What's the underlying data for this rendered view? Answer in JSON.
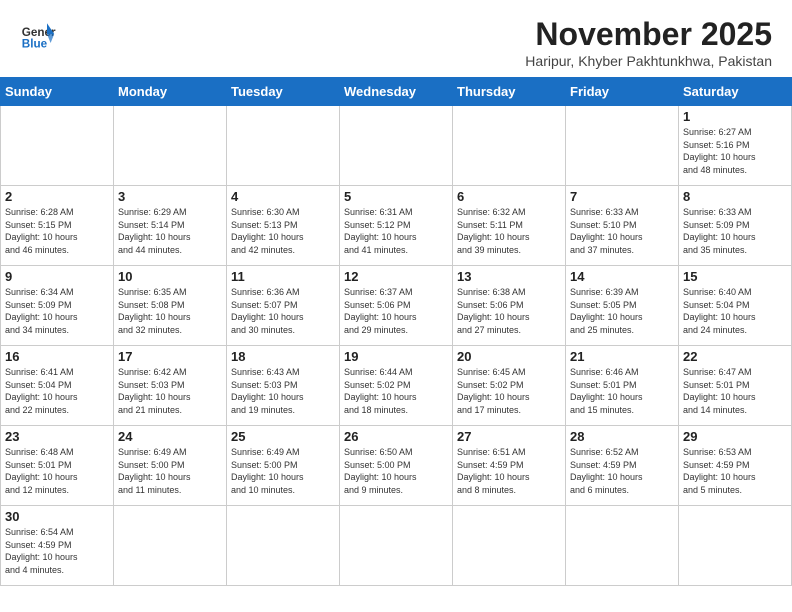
{
  "header": {
    "logo_general": "General",
    "logo_blue": "Blue",
    "month": "November 2025",
    "location": "Haripur, Khyber Pakhtunkhwa, Pakistan"
  },
  "days_of_week": [
    "Sunday",
    "Monday",
    "Tuesday",
    "Wednesday",
    "Thursday",
    "Friday",
    "Saturday"
  ],
  "weeks": [
    [
      {
        "day": "",
        "info": ""
      },
      {
        "day": "",
        "info": ""
      },
      {
        "day": "",
        "info": ""
      },
      {
        "day": "",
        "info": ""
      },
      {
        "day": "",
        "info": ""
      },
      {
        "day": "",
        "info": ""
      },
      {
        "day": "1",
        "info": "Sunrise: 6:27 AM\nSunset: 5:16 PM\nDaylight: 10 hours\nand 48 minutes."
      }
    ],
    [
      {
        "day": "2",
        "info": "Sunrise: 6:28 AM\nSunset: 5:15 PM\nDaylight: 10 hours\nand 46 minutes."
      },
      {
        "day": "3",
        "info": "Sunrise: 6:29 AM\nSunset: 5:14 PM\nDaylight: 10 hours\nand 44 minutes."
      },
      {
        "day": "4",
        "info": "Sunrise: 6:30 AM\nSunset: 5:13 PM\nDaylight: 10 hours\nand 42 minutes."
      },
      {
        "day": "5",
        "info": "Sunrise: 6:31 AM\nSunset: 5:12 PM\nDaylight: 10 hours\nand 41 minutes."
      },
      {
        "day": "6",
        "info": "Sunrise: 6:32 AM\nSunset: 5:11 PM\nDaylight: 10 hours\nand 39 minutes."
      },
      {
        "day": "7",
        "info": "Sunrise: 6:33 AM\nSunset: 5:10 PM\nDaylight: 10 hours\nand 37 minutes."
      },
      {
        "day": "8",
        "info": "Sunrise: 6:33 AM\nSunset: 5:09 PM\nDaylight: 10 hours\nand 35 minutes."
      }
    ],
    [
      {
        "day": "9",
        "info": "Sunrise: 6:34 AM\nSunset: 5:09 PM\nDaylight: 10 hours\nand 34 minutes."
      },
      {
        "day": "10",
        "info": "Sunrise: 6:35 AM\nSunset: 5:08 PM\nDaylight: 10 hours\nand 32 minutes."
      },
      {
        "day": "11",
        "info": "Sunrise: 6:36 AM\nSunset: 5:07 PM\nDaylight: 10 hours\nand 30 minutes."
      },
      {
        "day": "12",
        "info": "Sunrise: 6:37 AM\nSunset: 5:06 PM\nDaylight: 10 hours\nand 29 minutes."
      },
      {
        "day": "13",
        "info": "Sunrise: 6:38 AM\nSunset: 5:06 PM\nDaylight: 10 hours\nand 27 minutes."
      },
      {
        "day": "14",
        "info": "Sunrise: 6:39 AM\nSunset: 5:05 PM\nDaylight: 10 hours\nand 25 minutes."
      },
      {
        "day": "15",
        "info": "Sunrise: 6:40 AM\nSunset: 5:04 PM\nDaylight: 10 hours\nand 24 minutes."
      }
    ],
    [
      {
        "day": "16",
        "info": "Sunrise: 6:41 AM\nSunset: 5:04 PM\nDaylight: 10 hours\nand 22 minutes."
      },
      {
        "day": "17",
        "info": "Sunrise: 6:42 AM\nSunset: 5:03 PM\nDaylight: 10 hours\nand 21 minutes."
      },
      {
        "day": "18",
        "info": "Sunrise: 6:43 AM\nSunset: 5:03 PM\nDaylight: 10 hours\nand 19 minutes."
      },
      {
        "day": "19",
        "info": "Sunrise: 6:44 AM\nSunset: 5:02 PM\nDaylight: 10 hours\nand 18 minutes."
      },
      {
        "day": "20",
        "info": "Sunrise: 6:45 AM\nSunset: 5:02 PM\nDaylight: 10 hours\nand 17 minutes."
      },
      {
        "day": "21",
        "info": "Sunrise: 6:46 AM\nSunset: 5:01 PM\nDaylight: 10 hours\nand 15 minutes."
      },
      {
        "day": "22",
        "info": "Sunrise: 6:47 AM\nSunset: 5:01 PM\nDaylight: 10 hours\nand 14 minutes."
      }
    ],
    [
      {
        "day": "23",
        "info": "Sunrise: 6:48 AM\nSunset: 5:01 PM\nDaylight: 10 hours\nand 12 minutes."
      },
      {
        "day": "24",
        "info": "Sunrise: 6:49 AM\nSunset: 5:00 PM\nDaylight: 10 hours\nand 11 minutes."
      },
      {
        "day": "25",
        "info": "Sunrise: 6:49 AM\nSunset: 5:00 PM\nDaylight: 10 hours\nand 10 minutes."
      },
      {
        "day": "26",
        "info": "Sunrise: 6:50 AM\nSunset: 5:00 PM\nDaylight: 10 hours\nand 9 minutes."
      },
      {
        "day": "27",
        "info": "Sunrise: 6:51 AM\nSunset: 4:59 PM\nDaylight: 10 hours\nand 8 minutes."
      },
      {
        "day": "28",
        "info": "Sunrise: 6:52 AM\nSunset: 4:59 PM\nDaylight: 10 hours\nand 6 minutes."
      },
      {
        "day": "29",
        "info": "Sunrise: 6:53 AM\nSunset: 4:59 PM\nDaylight: 10 hours\nand 5 minutes."
      }
    ],
    [
      {
        "day": "30",
        "info": "Sunrise: 6:54 AM\nSunset: 4:59 PM\nDaylight: 10 hours\nand 4 minutes."
      },
      {
        "day": "",
        "info": ""
      },
      {
        "day": "",
        "info": ""
      },
      {
        "day": "",
        "info": ""
      },
      {
        "day": "",
        "info": ""
      },
      {
        "day": "",
        "info": ""
      },
      {
        "day": "",
        "info": ""
      }
    ]
  ]
}
